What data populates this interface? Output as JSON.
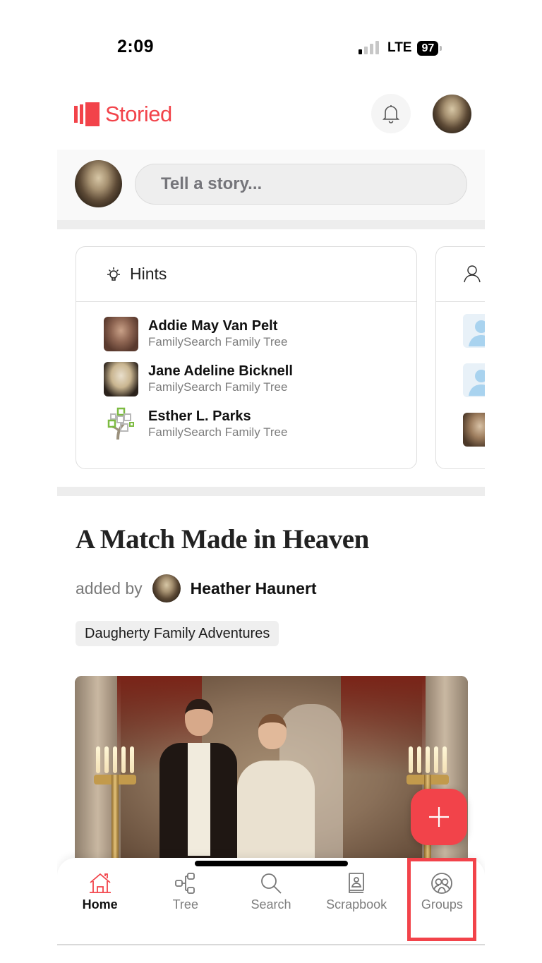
{
  "status_bar": {
    "time": "2:09",
    "network": "LTE",
    "battery": "97",
    "signal_bars_on": 1,
    "signal_bars_total": 4
  },
  "header": {
    "brand": "Storied",
    "brand_color": "#f2434a",
    "icons": {
      "logo": "storied-logo-icon",
      "notifications": "bell-icon",
      "profile": "avatar"
    }
  },
  "composer": {
    "placeholder": "Tell a story..."
  },
  "hints_card": {
    "title": "Hints",
    "icon": "lightbulb-icon",
    "items": [
      {
        "name": "Addie May Van Pelt",
        "source": "FamilySearch Family Tree",
        "thumb": "portrait-photo"
      },
      {
        "name": "Jane Adeline Bicknell",
        "source": "FamilySearch Family Tree",
        "thumb": "portrait-photo"
      },
      {
        "name": "Esther L. Parks",
        "source": "FamilySearch Family Tree",
        "thumb": "familysearch-tree-icon"
      }
    ]
  },
  "people_card": {
    "icon": "person-icon",
    "thumbs": [
      "silhouette-icon",
      "silhouette-icon",
      "portrait-photo"
    ]
  },
  "story": {
    "title": "A Match Made in Heaven",
    "added_by_label": "added by",
    "author": "Heather Haunert",
    "group_tag": "Daugherty Family Adventures",
    "image_alt": "Vintage wedding portrait of a groom and bride with candelabras"
  },
  "fab": {
    "icon": "plus-icon"
  },
  "bottom_nav": {
    "active": "Home",
    "highlighted": "Groups",
    "highlight_color": "#f2434a",
    "items": [
      {
        "label": "Home",
        "icon": "home-icon"
      },
      {
        "label": "Tree",
        "icon": "tree-icon"
      },
      {
        "label": "Search",
        "icon": "search-icon"
      },
      {
        "label": "Scrapbook",
        "icon": "scrapbook-icon"
      },
      {
        "label": "Groups",
        "icon": "groups-icon"
      }
    ]
  }
}
